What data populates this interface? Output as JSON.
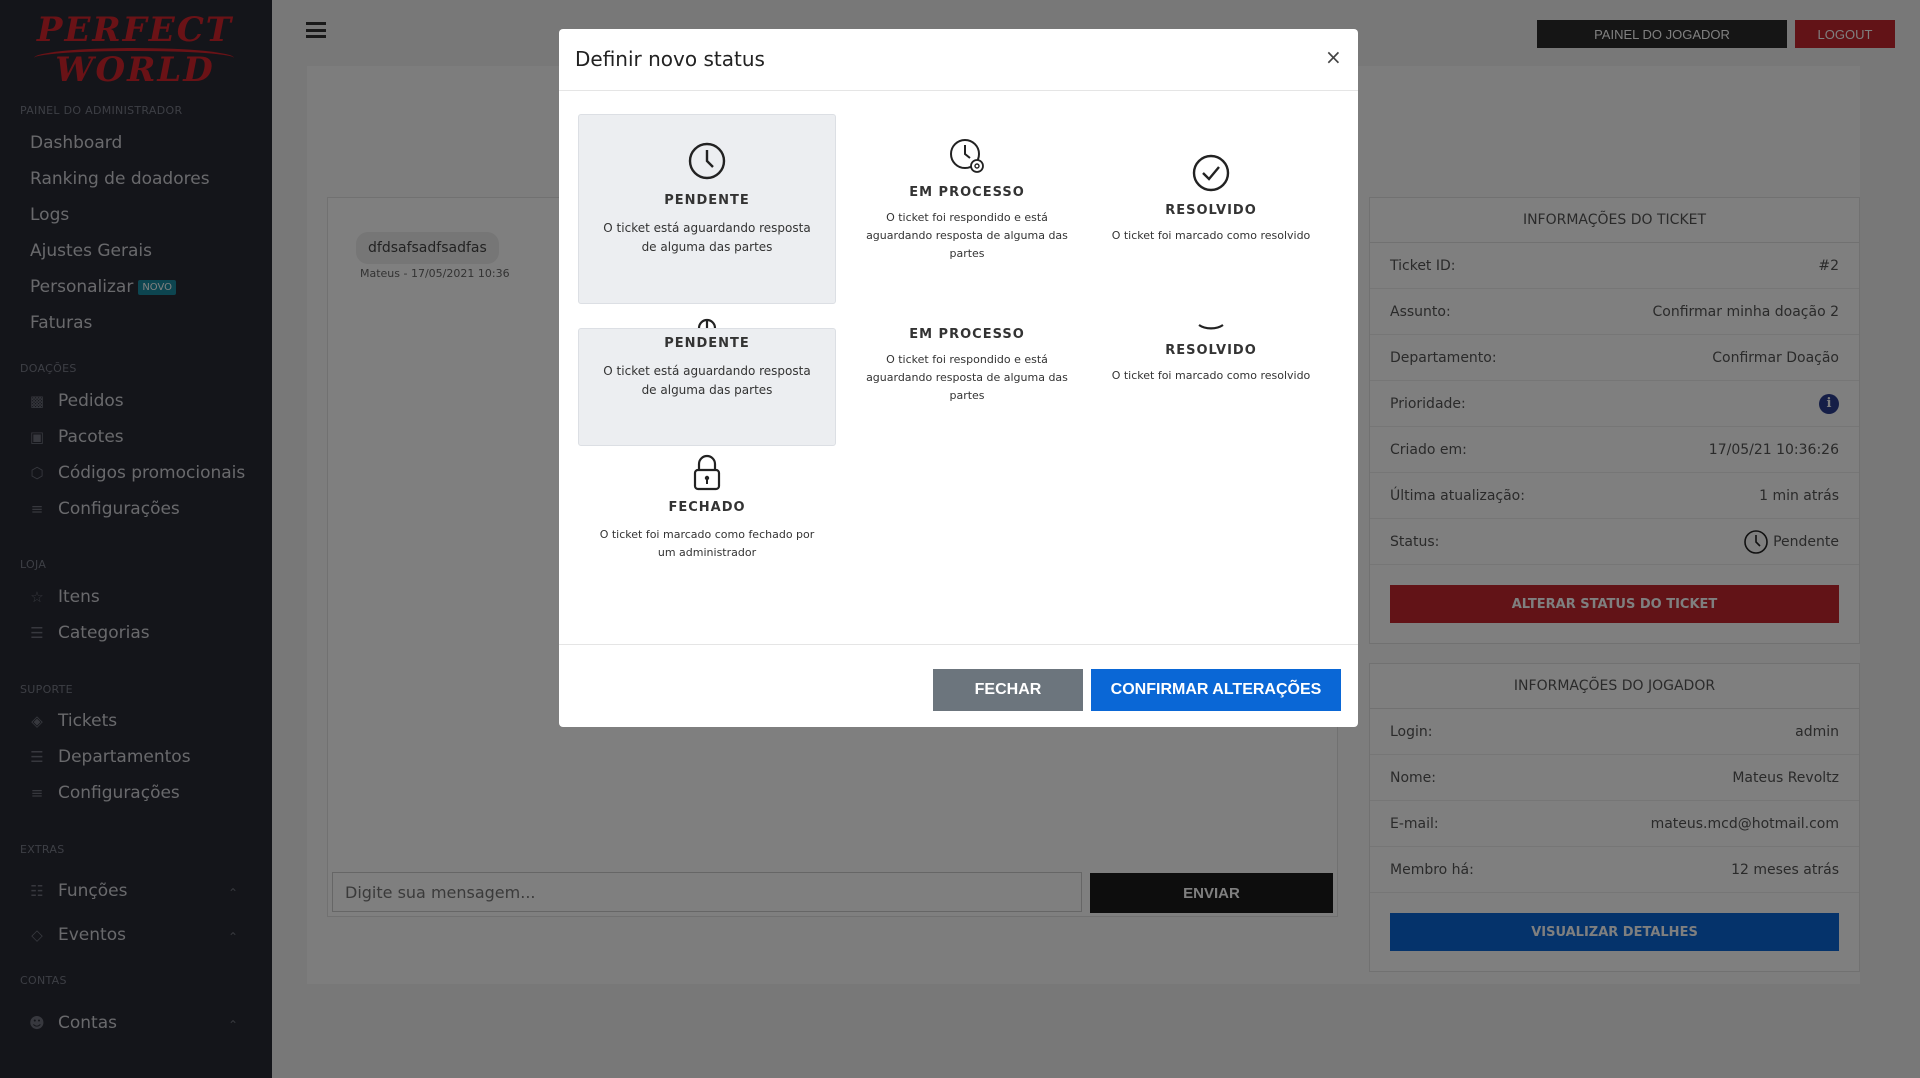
{
  "sidebar": {
    "logo_line1": "PERFECT",
    "logo_line2": "WORLD",
    "sections": {
      "admin": "PAINEL DO ADMINISTRADOR",
      "doacoes": "DOAÇÕES",
      "loja": "LOJA",
      "suporte": "SUPORTE",
      "extras": "EXTRAS",
      "contas": "CONTAS"
    },
    "admin_items": [
      "Dashboard",
      "Ranking de doadores",
      "Logs",
      "Ajustes Gerais",
      "Personalizar",
      "Faturas"
    ],
    "new_badge": "NOVO",
    "doacoes_items": [
      "Pedidos",
      "Pacotes",
      "Códigos promocionais",
      "Configurações"
    ],
    "loja_items": [
      "Itens",
      "Categorias"
    ],
    "suporte_items": [
      "Tickets",
      "Departamentos",
      "Configurações"
    ],
    "extras_items": [
      "Funções",
      "Eventos"
    ],
    "contas_items": [
      "Contas"
    ]
  },
  "topbar": {
    "painel_label": "PAINEL DO JOGADOR",
    "logout_label": "LOGOUT"
  },
  "chat": {
    "message": "dfdsafsadfsadfas",
    "meta": "Mateus - 17/05/2021 10:36",
    "input_placeholder": "Digite sua mensagem...",
    "send_label": "ENVIAR"
  },
  "ticket_info": {
    "title": "INFORMAÇÕES DO TICKET",
    "rows": [
      {
        "label": "Ticket ID:",
        "value": "#2"
      },
      {
        "label": "Assunto:",
        "value": "Confirmar minha doação 2"
      },
      {
        "label": "Departamento:",
        "value": "Confirmar Doação"
      },
      {
        "label": "Prioridade:",
        "value": ""
      },
      {
        "label": "Criado em:",
        "value": "17/05/21 10:36:26"
      },
      {
        "label": "Última atualização:",
        "value": "1 min atrás"
      },
      {
        "label": "Status:",
        "value": "Pendente"
      }
    ],
    "change_status_label": "ALTERAR STATUS DO TICKET",
    "change_status_color": "#c4262e"
  },
  "player_info": {
    "title": "INFORMAÇÕES DO JOGADOR",
    "rows": [
      {
        "label": "Login:",
        "value": "admin"
      },
      {
        "label": "Nome:",
        "value": "Mateus Revoltz"
      },
      {
        "label": "E-mail:",
        "value": "mateus.mcd@hotmail.com"
      },
      {
        "label": "Membro há:",
        "value": "12 meses atrás"
      }
    ],
    "details_label": "VISUALIZAR DETALHES",
    "details_color": "#0a67d6"
  },
  "modal": {
    "title": "Definir novo status",
    "close_glyph": "×",
    "statuses": [
      {
        "name": "PENDENTE",
        "desc": "O ticket está aguardando resposta de alguma das partes",
        "icon": "clock-icon"
      },
      {
        "name": "EM PROCESSO",
        "desc": "O ticket foi respondido e está aguardando resposta de alguma das partes",
        "icon": "clock-gear-icon"
      },
      {
        "name": "RESOLVIDO",
        "desc": "O ticket foi marcado como resolvido",
        "icon": "check-circle-icon"
      },
      {
        "name": "PENDENTE",
        "desc": "O ticket está aguardando resposta de alguma das partes",
        "icon": "clock-icon"
      },
      {
        "name": "EM PROCESSO",
        "desc": "O ticket foi respondido e está aguardando resposta de alguma das partes",
        "icon": "clock-gear-icon"
      },
      {
        "name": "RESOLVIDO",
        "desc": "O ticket foi marcado como resolvido",
        "icon": "check-circle-icon"
      },
      {
        "name": "FECHADO",
        "desc": "O ticket foi marcado como fechado por um administrador",
        "icon": "lock-icon"
      }
    ],
    "close_button": "FECHAR",
    "confirm_button": "CONFIRMAR ALTERAÇÕES"
  }
}
